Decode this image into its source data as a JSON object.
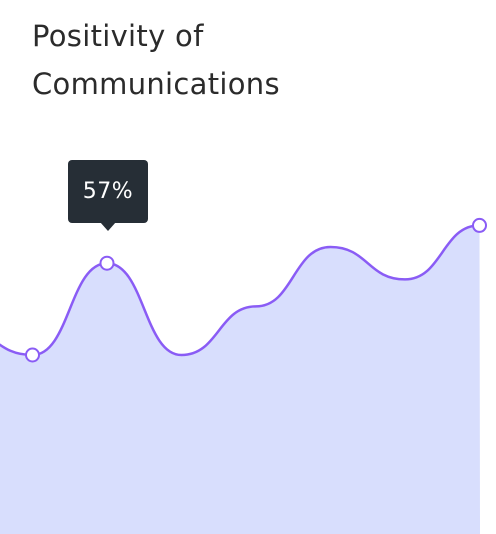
{
  "card": {
    "title_line1": "Positivity of",
    "title_line2": "Communications"
  },
  "tooltip": {
    "value_label": "57%"
  },
  "colors": {
    "line": "#8a5cf5",
    "area": "#d8defd",
    "tooltip_bg": "#262e36",
    "title": "#2b2b2b"
  },
  "chart_data": {
    "type": "area",
    "series": [
      {
        "values": [
          45,
          40,
          57,
          40,
          49,
          60,
          54,
          64
        ]
      }
    ],
    "highlighted_index": 2,
    "marked_indices": [
      1,
      2,
      7
    ],
    "ylim": [
      0,
      100
    ],
    "grid": false,
    "legend": "none"
  }
}
